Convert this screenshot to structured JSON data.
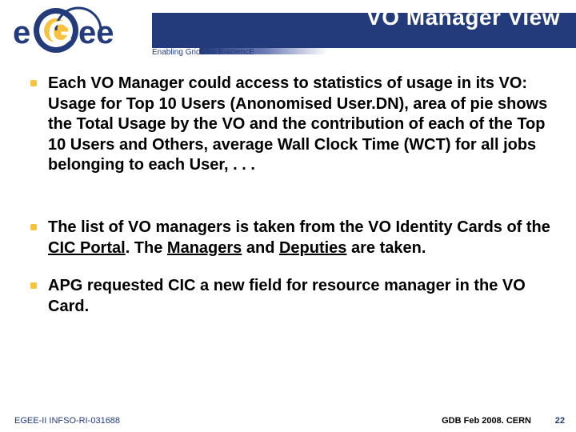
{
  "header": {
    "title": "VO Manager View",
    "tagline": "Enabling Grids for E-sciencE"
  },
  "logo": {
    "text_primary": "e",
    "text_rest": "ee",
    "g_label": "G"
  },
  "bullets": [
    "Each VO Manager could access to statistics of usage in its VO: Usage for Top 10 Users (Anonomised User.DN), area of pie shows the Total Usage by the VO and the contribution of each of the Top 10 Users and Others, average Wall Clock Time (WCT) for all jobs belonging to each User, . . .",
    "The list of VO managers is taken from the VO Identity Cards of the {u}CIC Portal{/u}. The {u}Managers{/u} and {u}Deputies{/u} are taken.",
    "APG requested CIC a new field for resource manager in the VO Card."
  ],
  "footer": {
    "left": "EGEE-II INFSO-RI-031688",
    "right": "GDB Feb 2008. CERN",
    "page": "22"
  }
}
